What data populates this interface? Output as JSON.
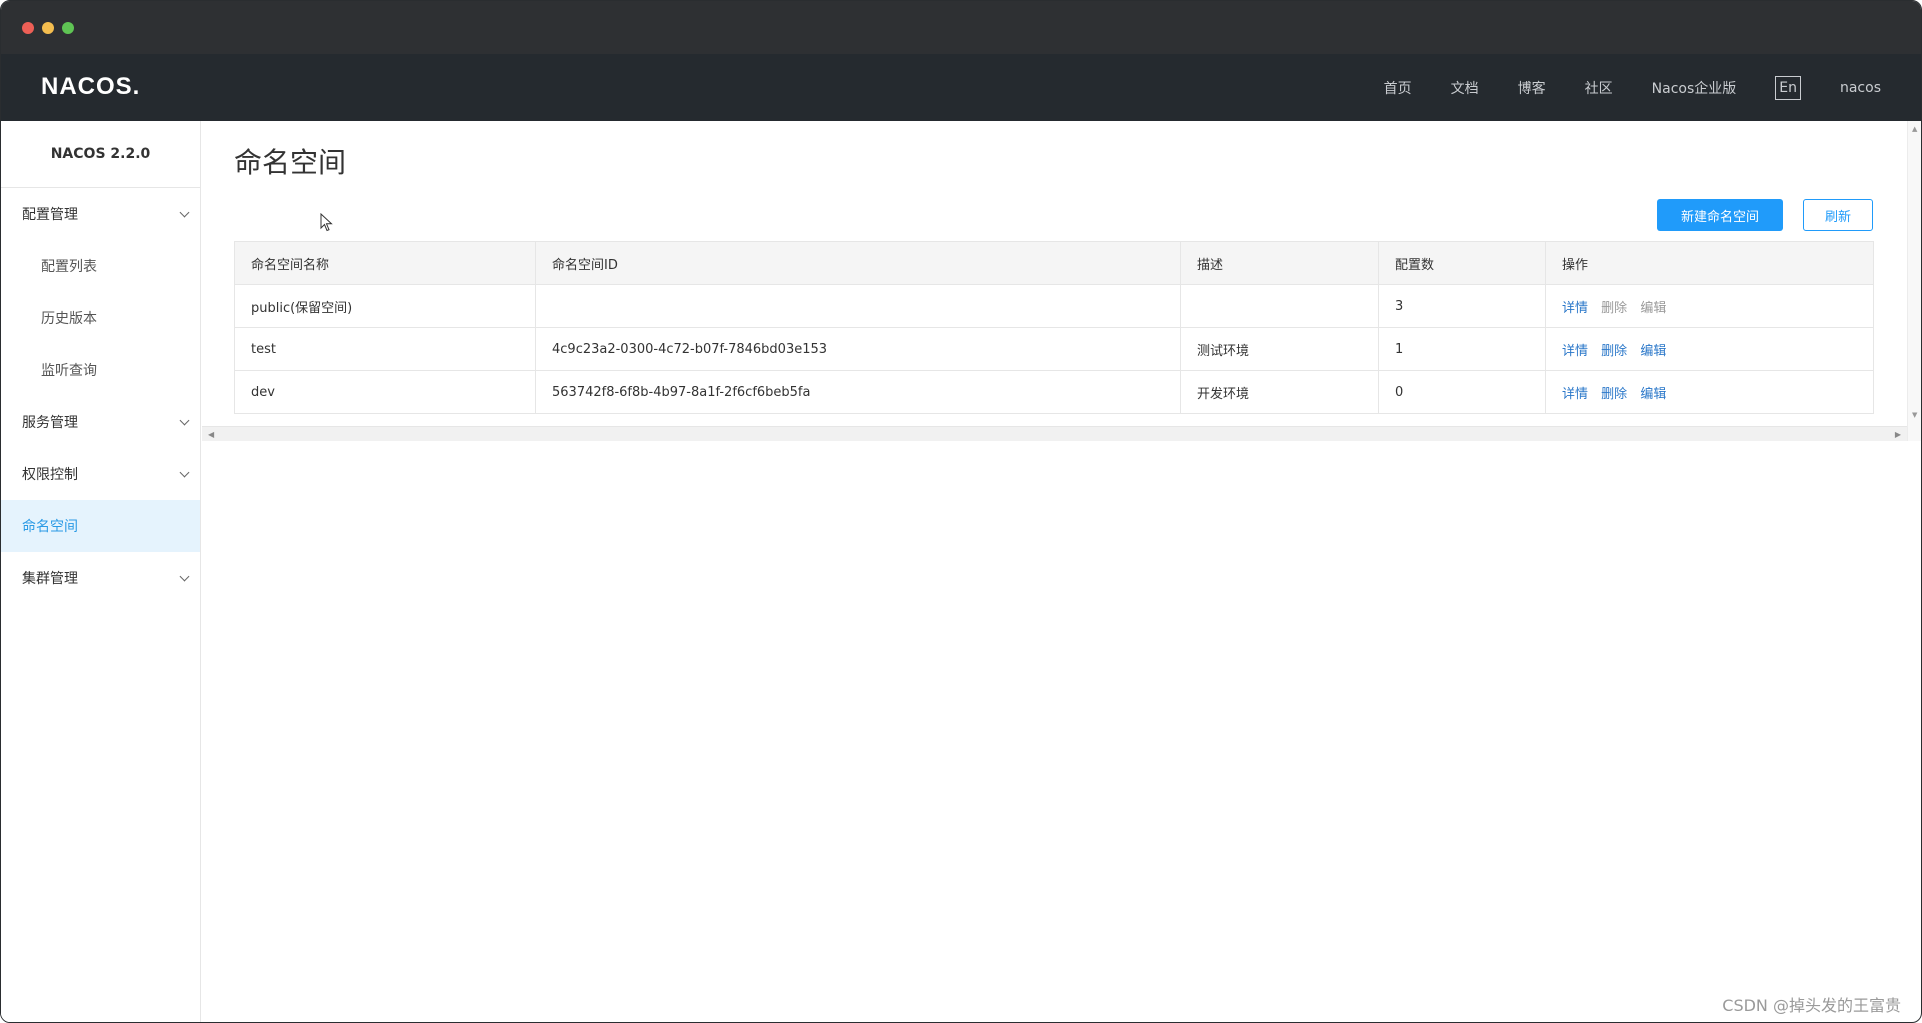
{
  "app": {
    "logo_text": "NACOS.",
    "version": "NACOS 2.2.0"
  },
  "topnav": {
    "links": [
      "首页",
      "文档",
      "博客",
      "社区",
      "Nacos企业版"
    ],
    "lang": "En",
    "user": "nacos"
  },
  "sidebar": {
    "groups": [
      {
        "label": "配置管理",
        "expanded": true,
        "items": [
          "配置列表",
          "历史版本",
          "监听查询"
        ]
      },
      {
        "label": "服务管理"
      },
      {
        "label": "权限控制"
      }
    ],
    "active_item": "命名空间",
    "last_group": "集群管理"
  },
  "page": {
    "title": "命名空间",
    "new_button": "新建命名空间",
    "refresh_button": "刷新"
  },
  "table": {
    "headers": [
      "命名空间名称",
      "命名空间ID",
      "描述",
      "配置数",
      "操作"
    ],
    "rows": [
      {
        "name": "public(保留空间)",
        "id": "",
        "desc": "",
        "count": "3",
        "ops_enabled": false
      },
      {
        "name": "test",
        "id": "4c9c23a2-0300-4c72-b07f-7846bd03e153",
        "desc": "测试环境",
        "count": "1",
        "ops_enabled": true
      },
      {
        "name": "dev",
        "id": "563742f8-6f8b-4b97-8a1f-2f6cf6beb5fa",
        "desc": "开发环境",
        "count": "0",
        "ops_enabled": true
      }
    ],
    "ops": {
      "detail": "详情",
      "delete": "删除",
      "edit": "编辑"
    }
  },
  "watermark": "CSDN @掉头发的王富贵",
  "colors": {
    "accent": "#209bfa",
    "link": "#2a77c9",
    "nav_bg": "#252a2f",
    "active_bg": "#e5f3fd"
  }
}
